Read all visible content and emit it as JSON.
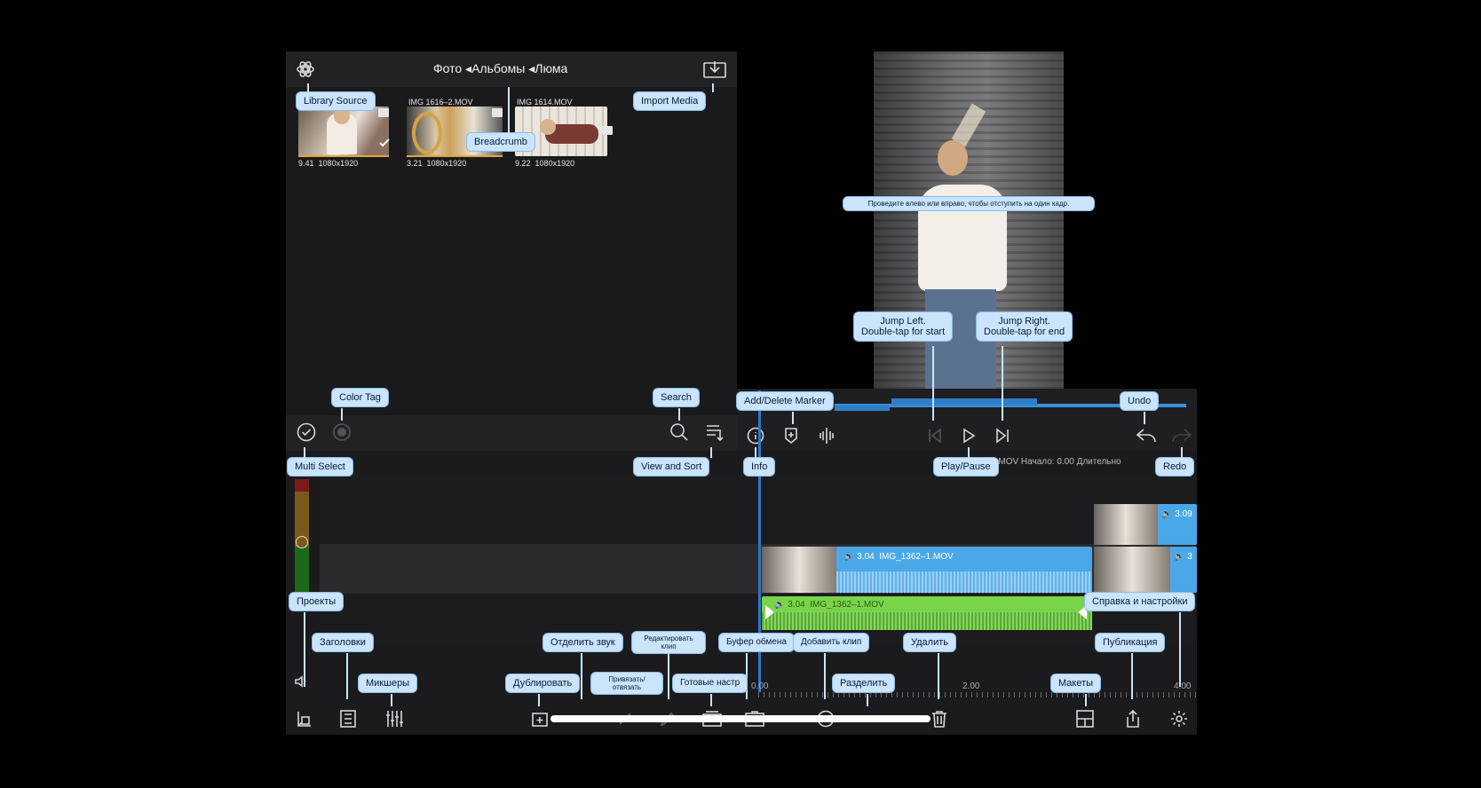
{
  "library": {
    "breadcrumb": "Фото ◂Альбомы ◂Люма",
    "clips": [
      {
        "name": "",
        "duration": "9.41",
        "resolution": "1080x1920"
      },
      {
        "name": "IMG 1616–2.MOV",
        "duration": "3.21",
        "resolution": "1080x1920"
      },
      {
        "name": "IMG 1614.MOV",
        "duration": "9.22",
        "resolution": "1080x1920"
      }
    ]
  },
  "timeline": {
    "info_text": "IMG_1362-1.MOV Начало: 0.00 Длительно",
    "clip_main_duration": "3.04",
    "clip_main_name": "IMG_1362–1.MOV",
    "clip_green_duration": "3.04",
    "clip_green_name": "IMG_1362–1.MOV",
    "clip_right_duration": "3.09",
    "clip_right2_label": "3",
    "ruler_start": "0.00",
    "ruler_mid": "2.00",
    "ruler_end": "4.00"
  },
  "tips": {
    "library_source": "Library Source",
    "import_media": "Import Media",
    "breadcrumb": "Breadcrumb",
    "color_tag": "Color Tag",
    "search": "Search",
    "multi_select": "Multi Select",
    "view_sort": "View and Sort",
    "add_marker": "Add/Delete Marker",
    "undo": "Undo",
    "info": "Info",
    "play_pause": "Play/Pause",
    "redo": "Redo",
    "jump_left": "Jump Left.\nDouble-tap for start",
    "jump_right": "Jump Right.\nDouble-tap for end",
    "frame_hint": "Проведите влево или вправо, чтобы отступить на один кадр.",
    "projects": "Проекты",
    "titles": "Заголовки",
    "mixers": "Микшеры",
    "split_audio": "Отделить звук",
    "edit_clip": "Редактировать клип",
    "clipboard": "Буфер обмена",
    "add_clip": "Добавить клип",
    "delete": "Удалить",
    "help_settings": "Справка и настройки",
    "publish": "Публикация",
    "duplicate": "Дублировать",
    "link_unlink": "Привязать/ отвязать",
    "presets": "Готовые настр",
    "split": "Разделить",
    "layouts": "Макеты"
  }
}
